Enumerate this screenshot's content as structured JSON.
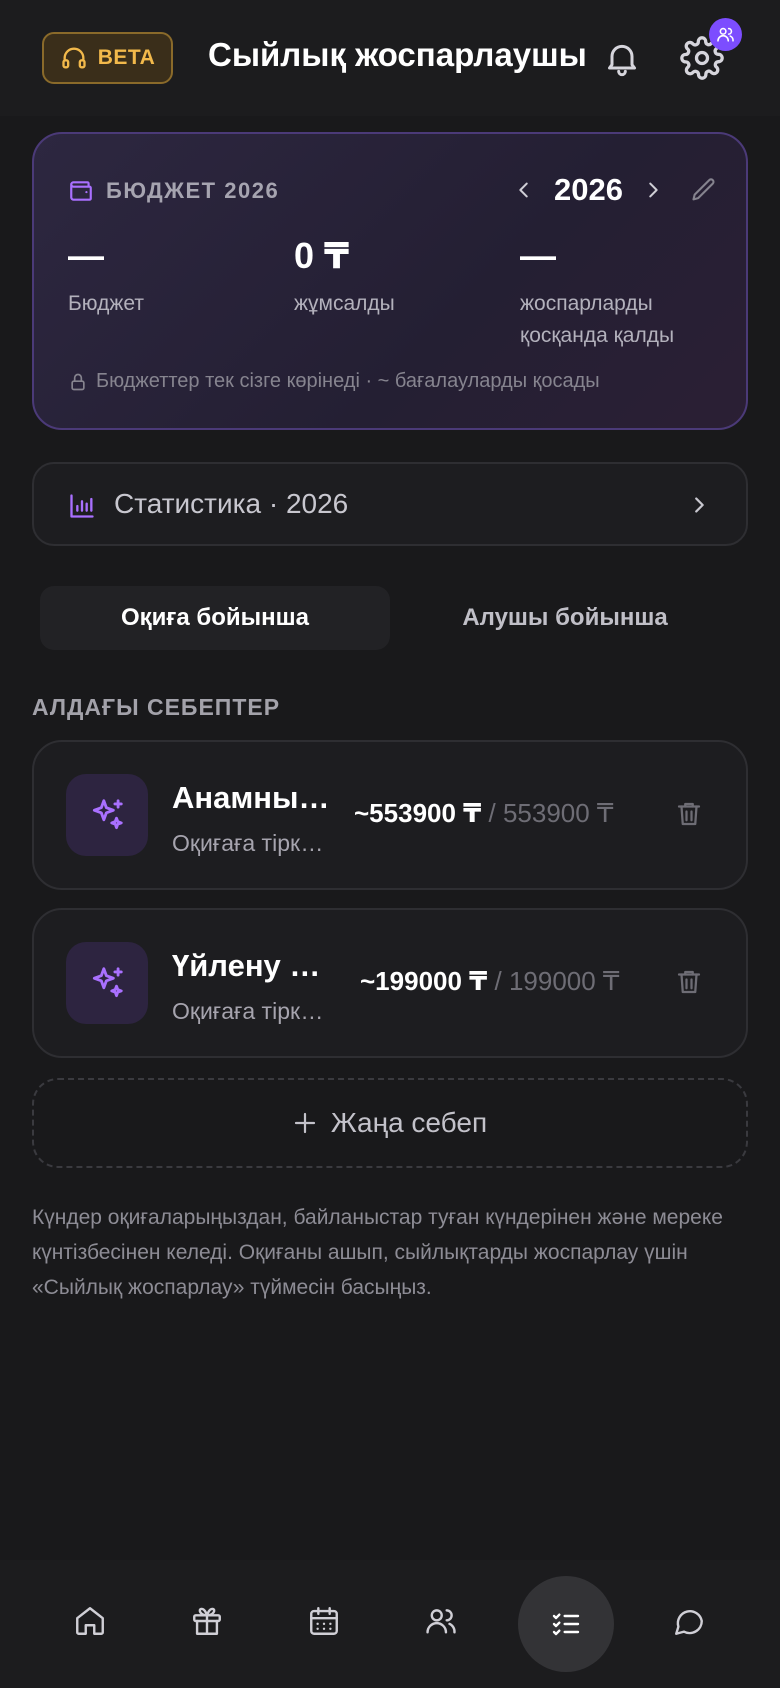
{
  "header": {
    "beta_label": "BETA",
    "title": "Сыйлық жоспарлаушы"
  },
  "budget": {
    "label": "БЮДЖЕТ 2026",
    "year": "2026",
    "stats": [
      {
        "value": "—",
        "label": "Бюджет"
      },
      {
        "value": "0 ₸",
        "label": "жұмсалды"
      },
      {
        "value": "—",
        "label": "жоспарларды қосқанда қалды"
      }
    ],
    "privacy_note": "Бюджеттер тек сізге көрінеді · ~ бағалауларды қосады"
  },
  "stats_row": {
    "label": "Статистика · 2026"
  },
  "tabs": [
    {
      "label": "Оқиға бойынша",
      "active": true
    },
    {
      "label": "Алушы бойынша",
      "active": false
    }
  ],
  "section_title": "АЛДАҒЫ СЕБЕПТЕР",
  "events": [
    {
      "name": "Анамның туған күні",
      "subtitle": "Оқиғаға тіркелген",
      "estimate": "~553900 ₸",
      "separator": " / ",
      "total": "553900 ₸"
    },
    {
      "name": "Үйлену тойы",
      "subtitle": "Оқиғаға тіркелген",
      "estimate": "~199000 ₸",
      "separator": " / ",
      "total": "199000 ₸"
    }
  ],
  "add_button": {
    "label": "Жаңа себеп"
  },
  "info_text": "Күндер оқиғаларыңыздан, байланыстар туған күндерінен және мереке күнтізбесінен келеді. Оқиғаны ашып, сыйлықтарды жоспарлау үшін «Сыйлық жоспарлау» түймесін басыңыз.",
  "nav": [
    {
      "icon": "home-icon"
    },
    {
      "icon": "gift-icon"
    },
    {
      "icon": "calendar-icon"
    },
    {
      "icon": "contacts-icon"
    },
    {
      "icon": "checklist-icon",
      "active": true
    },
    {
      "icon": "chat-icon"
    }
  ],
  "colors": {
    "accent": "#a970ff",
    "beta": "#f2b94b",
    "badge": "#7c4dff",
    "background": "#19191b"
  }
}
